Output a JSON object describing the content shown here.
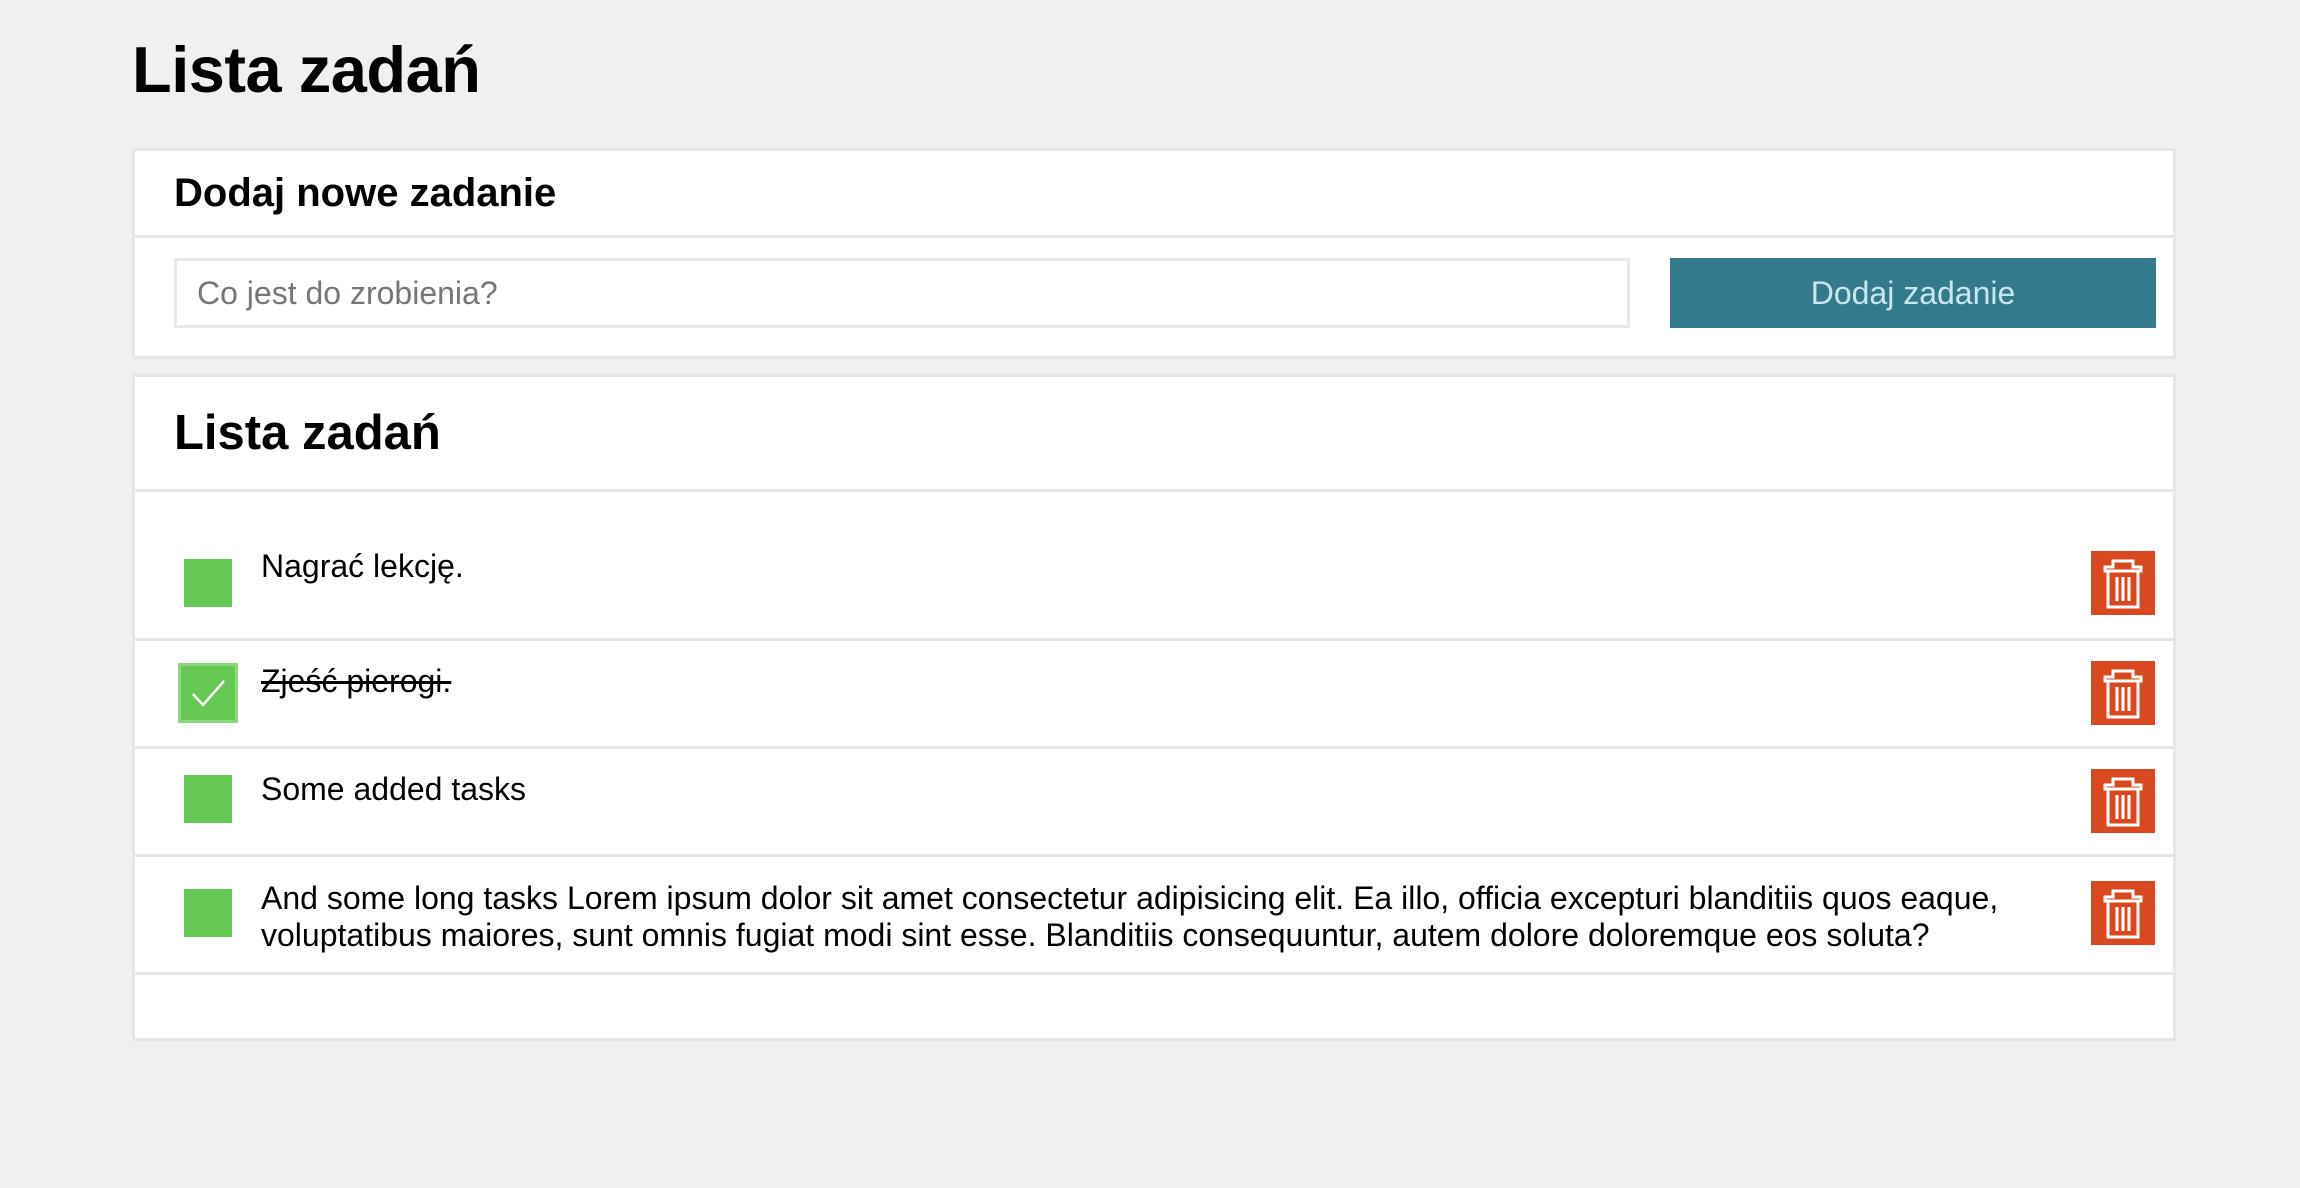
{
  "page": {
    "title": "Lista zadań"
  },
  "add_panel": {
    "heading": "Dodaj nowe zadanie",
    "input_placeholder": "Co jest do zrobienia?",
    "input_value": "",
    "button_label": "Dodaj zadanie"
  },
  "list_panel": {
    "heading": "Lista zadań",
    "tasks": [
      {
        "text": "Nagrać lekcję.",
        "done": false
      },
      {
        "text": "Zjeść pierogi.",
        "done": true
      },
      {
        "text": "Some added tasks",
        "done": false
      },
      {
        "text": "And some long tasks Lorem ipsum dolor sit amet consectetur adipisicing elit. Ea illo, officia excepturi blanditiis quos eaque, voluptatibus maiores, sunt omnis fugiat modi sint esse. Blanditiis consequuntur, autem dolore doloremque eos soluta?",
        "done": false
      }
    ]
  },
  "colors": {
    "background": "#f0f0f0",
    "panel": "#ffffff",
    "border": "#e6e6e6",
    "button": "#337a8c",
    "button_text": "#c9e6ee",
    "checkbox": "#66c954",
    "delete": "#d9481f"
  },
  "icons": {
    "checkbox_checked": "checkmark-icon",
    "delete": "trash-icon"
  }
}
